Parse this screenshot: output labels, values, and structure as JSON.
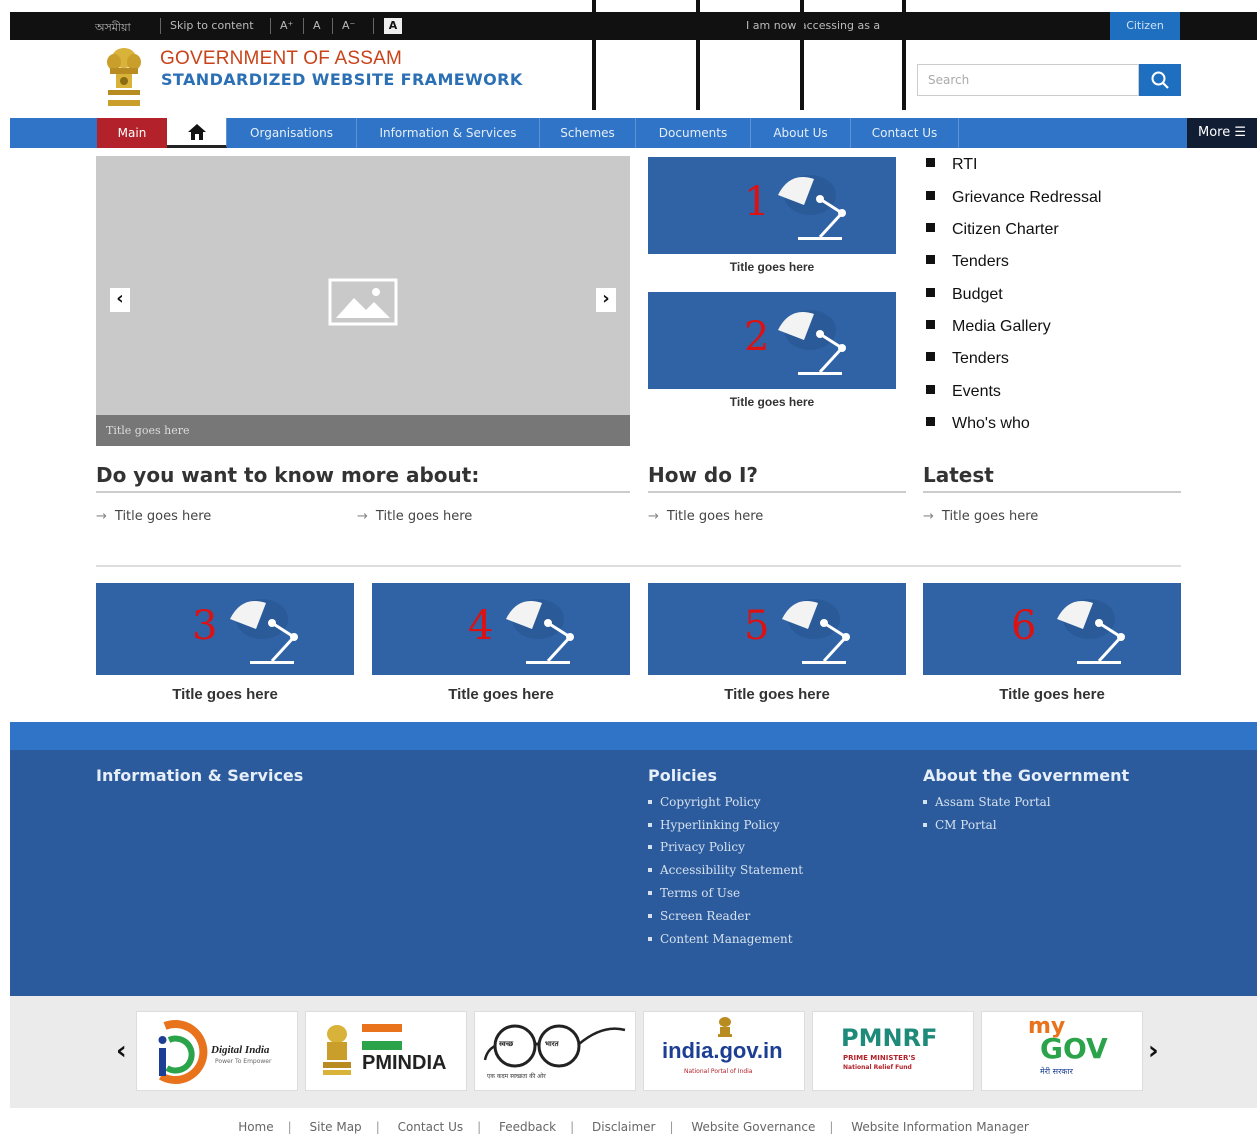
{
  "topbar": {
    "lang": "অসমীয়া",
    "skip": "Skip to content",
    "font_plus": "A⁺",
    "font_normal": "A",
    "font_minus": "A⁻",
    "contrast": "A",
    "accessing": "I am now accessing as a",
    "citizen": "Citizen"
  },
  "header": {
    "title_line1": "GOVERNMENT OF ASSAM",
    "title_line2": "STANDARDIZED WEBSITE FRAMEWORK",
    "search_placeholder": "Search"
  },
  "nav": {
    "main": "Main",
    "items": [
      "Organisations",
      "Information & Services",
      "Schemes",
      "Documents",
      "About Us",
      "Contact Us"
    ],
    "more": "More"
  },
  "slider": {
    "caption": "Title goes here"
  },
  "feature_tiles": [
    {
      "num": "1",
      "title": "Title goes here"
    },
    {
      "num": "2",
      "title": "Title goes here"
    }
  ],
  "quick_links": [
    "RTI",
    "Grievance Redressal",
    "Citizen Charter",
    "Tenders",
    "Budget",
    "Media Gallery",
    "Tenders",
    "Events",
    "Who's who"
  ],
  "sections": {
    "know_more": {
      "heading": "Do you want to know more about:",
      "links": [
        "Title goes here",
        "Title goes here"
      ]
    },
    "how_do_i": {
      "heading": "How do I?",
      "links": [
        "Title goes here"
      ]
    },
    "latest": {
      "heading": "Latest",
      "links": [
        "Title goes here"
      ]
    }
  },
  "bottom_tiles": [
    {
      "num": "3",
      "title": "Title goes here"
    },
    {
      "num": "4",
      "title": "Title goes here"
    },
    {
      "num": "5",
      "title": "Title goes here"
    },
    {
      "num": "6",
      "title": "Title goes here"
    }
  ],
  "footer": {
    "info_heading": "Information & Services",
    "policies_heading": "Policies",
    "policies": [
      "Copyright Policy",
      "Hyperlinking Policy",
      "Privacy Policy",
      "Accessibility Statement",
      "Terms of Use",
      "Screen Reader",
      "Content Management"
    ],
    "about_heading": "About the Government",
    "about": [
      "Assam State Portal",
      "CM Portal"
    ]
  },
  "logos": {
    "digital_india": "Digital India",
    "digital_india_sub": "Power To Empower",
    "pmindia": "PMINDIA",
    "swachh_a": "स्वच्छ",
    "swachh_b": "भारत",
    "swachh_sub": "एक कदम स्वच्छता की ओर",
    "india_gov": "india.gov.in",
    "india_gov_sub": "National Portal of India",
    "pmnrf": "PMNRF",
    "pmnrf_sub1": "PRIME MINISTER'S",
    "pmnrf_sub2": "National Relief Fund",
    "mygov_my": "my",
    "mygov_gov": "GOV",
    "mygov_sub": "मेरी सरकार"
  },
  "bottom_links": [
    "Home",
    "Site Map",
    "Contact Us",
    "Feedback",
    "Disclaimer",
    "Website Governance",
    "Website Information Manager"
  ],
  "colors": {
    "nav_blue": "#2f74c6",
    "footer_blue": "#2b5b9c",
    "tile_blue": "#2f63a6",
    "main_red": "#b3222a",
    "title_orange": "#c9431a"
  }
}
